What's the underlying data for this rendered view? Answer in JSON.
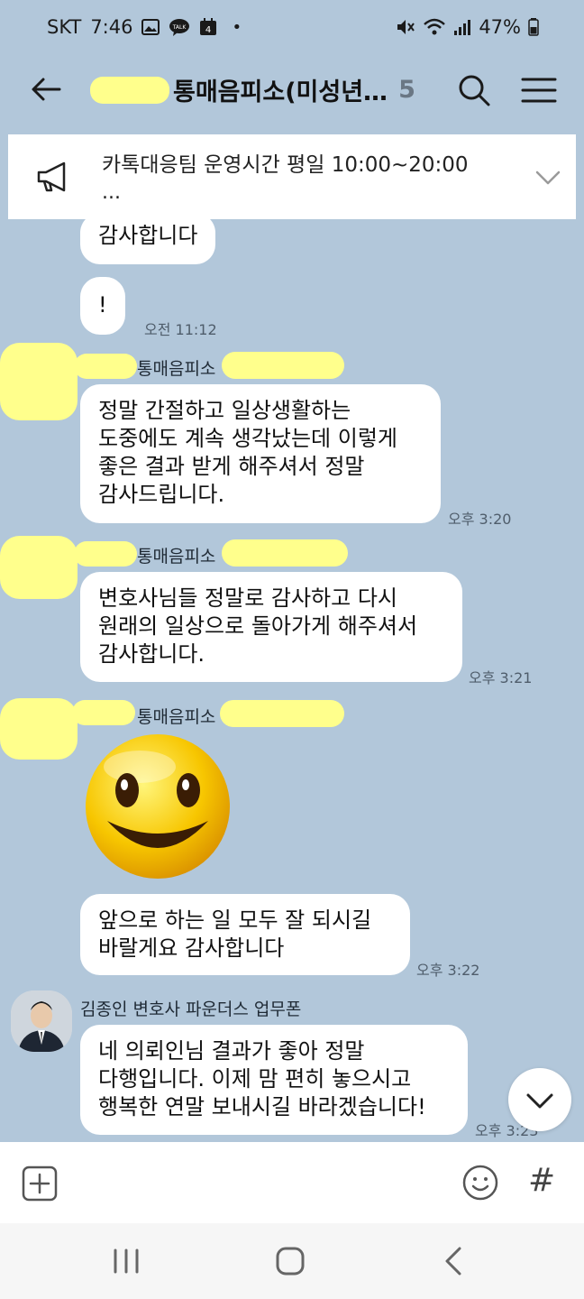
{
  "status_bar": {
    "carrier": "SKT",
    "time": "7:46",
    "talk_badge": "TALK",
    "notification_count": "4",
    "dot": "•",
    "battery": "47%"
  },
  "header": {
    "title": "통매음피소(미성년…",
    "member_count": "5"
  },
  "notice": {
    "text": "카톡대응팀 운영시간 평일 10:00~20:00",
    "more": "..."
  },
  "messages": [
    {
      "text": "감사합니다"
    },
    {
      "text": "!",
      "time": "오전 11:12"
    },
    {
      "sender": "통매음피소",
      "lines": [
        "정말 간절하고 일상생활하는",
        "도중에도 계속 생각났는데 이렇게",
        "좋은 결과 받게 해주셔서 정말",
        "감사드립니다."
      ],
      "time": "오후 3:20"
    },
    {
      "sender": "통매음피소",
      "lines": [
        "변호사님들 정말로 감사하고 다시",
        "원래의 일상으로 돌아가게 해주셔서",
        "감사합니다."
      ],
      "time": "오후 3:21"
    },
    {
      "sender": "통매음피소",
      "emoticon": "smiley-face",
      "lines": [
        "앞으로 하는 일 모두 잘 되시길",
        "바랄게요 감사합니다"
      ],
      "time": "오후 3:22"
    },
    {
      "sender": "김종인 변호사 파운더스 업무폰",
      "lines": [
        "네 의뢰인님 결과가 좋아 정말",
        "다행입니다. 이제 맘 편히 놓으시고",
        "행복한 연말 보내시길 바라겠습니다!"
      ],
      "time": "오후 3:23"
    }
  ],
  "input_bar": {
    "hash": "#"
  },
  "icons": [
    "back-arrow-icon",
    "search-icon",
    "menu-icon",
    "megaphone-icon",
    "chevron-down-icon",
    "plus-icon",
    "emoji-icon",
    "hash-icon",
    "recent-apps-icon",
    "home-icon",
    "nav-back-icon"
  ],
  "colors": {
    "chat_background": "#b2c7da",
    "bubble": "#ffffff",
    "redaction_highlight": "#ffff8c"
  }
}
